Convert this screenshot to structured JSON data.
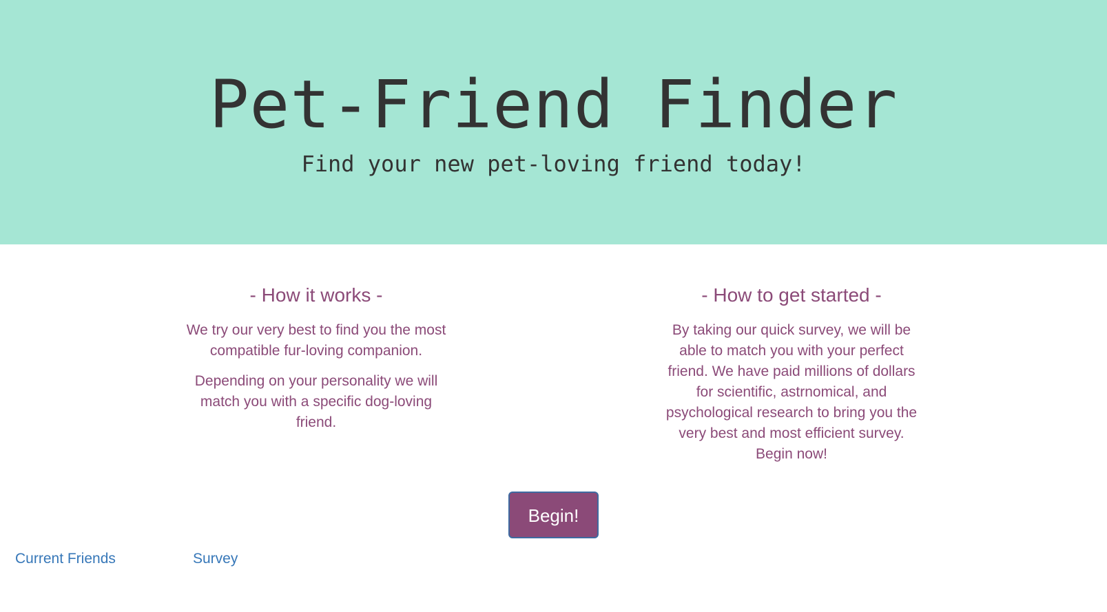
{
  "hero": {
    "title": "Pet-Friend Finder",
    "subtitle": "Find your new pet-loving friend today!",
    "background_color": "#a5e6d4"
  },
  "how_it_works": {
    "heading": "- How it works -",
    "paragraphs": [
      "We try our very best to find you the most compatible fur-loving companion.",
      "Depending on your personality we will match you with a specific dog-loving friend."
    ]
  },
  "how_to_start": {
    "heading": "- How to get started -",
    "paragraphs": [
      "By taking our quick survey, we will be able to match you with your perfect friend. We have paid millions of dollars for scientific, astrnomical, and psychological research to bring you the very best and most efficient survey. Begin now!"
    ]
  },
  "begin_button": {
    "label": "Begin!",
    "color": "#8b4a78"
  },
  "nav": {
    "links": [
      {
        "label": "Current Friends"
      },
      {
        "label": "Survey"
      }
    ],
    "link_color": "#3677b8"
  },
  "text_color": "#8b4a78"
}
